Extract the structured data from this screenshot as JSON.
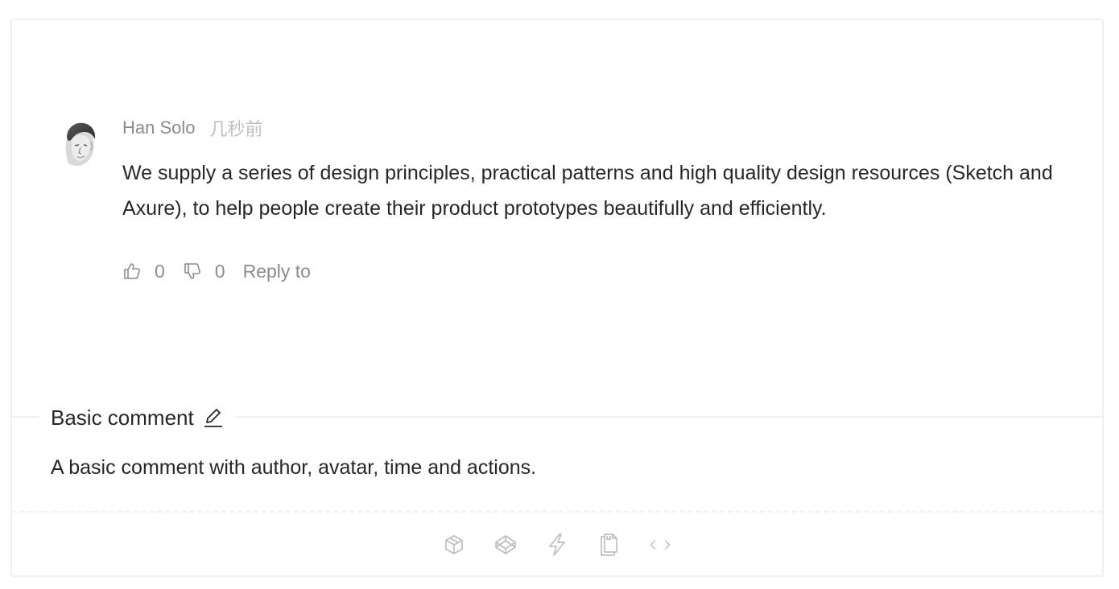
{
  "comment": {
    "author": "Han Solo",
    "time": "几秒前",
    "content": "We supply a series of design principles, practical patterns and high quality design resources (Sketch and Axure), to help people create their product prototypes beautifully and efficiently.",
    "actions": {
      "like_count": "0",
      "dislike_count": "0",
      "reply_label": "Reply to"
    }
  },
  "meta": {
    "title": "Basic comment",
    "description": "A basic comment with author, avatar, time and actions."
  },
  "toolbar": {
    "icons": [
      "codesandbox-icon",
      "codepen-icon",
      "thunderbolt-icon",
      "copy-icon",
      "code-icon"
    ]
  },
  "colors": {
    "text": "#262626",
    "secondary": "#8c8c8c",
    "muted": "#bfbfbf",
    "border": "#f0f0f0"
  }
}
